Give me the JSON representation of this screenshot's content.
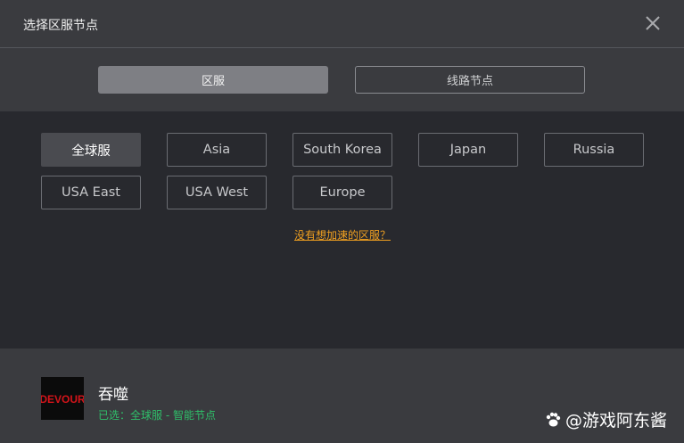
{
  "window": {
    "title": "选择区服节点"
  },
  "tabs": [
    {
      "label": "区服",
      "active": true
    },
    {
      "label": "线路节点",
      "active": false
    }
  ],
  "regions": [
    {
      "label": "全球服",
      "selected": true
    },
    {
      "label": "Asia",
      "selected": false
    },
    {
      "label": "South Korea",
      "selected": false
    },
    {
      "label": "Japan",
      "selected": false
    },
    {
      "label": "Russia",
      "selected": false
    },
    {
      "label": "USA East",
      "selected": false
    },
    {
      "label": "USA West",
      "selected": false
    },
    {
      "label": "Europe",
      "selected": false
    }
  ],
  "hint": {
    "label": "没有想加速的区服？"
  },
  "footer": {
    "game_name": "吞噬",
    "cover_text": "DEVOUR",
    "selected_text": "已选：全球服 - 智能节点"
  },
  "watermark": {
    "text": "@游戏阿东酱"
  },
  "colors": {
    "accent_green": "#2fbf6a",
    "hint_orange": "#f0a020",
    "cover_red": "#d4141a"
  }
}
